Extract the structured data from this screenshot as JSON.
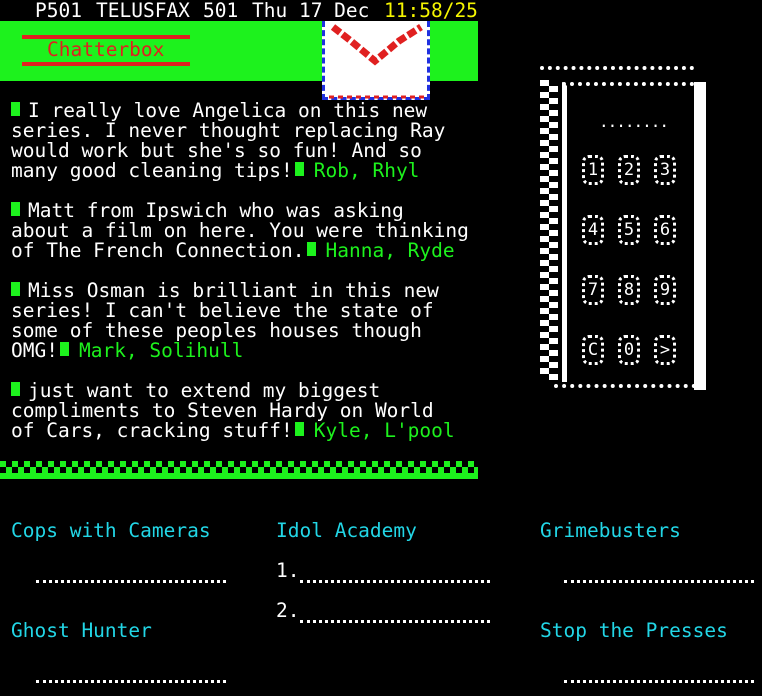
{
  "header": {
    "page_number": "P501",
    "service": "TELUSFAX",
    "page": "501",
    "date": "Thu 17 Dec",
    "time": "11:58/25"
  },
  "banner": {
    "title": "Chatterbox",
    "icon": "envelope-icon",
    "bg_color": "#1df21d",
    "title_color": "#e02020"
  },
  "messages": [
    {
      "lines": [
        "I really love Angelica on this new",
        "series. I never thought replacing Ray",
        "would work but she's so fun! And so",
        "many good cleaning tips!"
      ],
      "author": "Rob, Rhyl"
    },
    {
      "lines": [
        "Matt from Ipswich who was asking",
        "about a film on here. You were thinking",
        "of The French Connection."
      ],
      "author": "Hanna, Ryde"
    },
    {
      "lines": [
        "Miss Osman is brilliant in this new",
        "series! I can't believe the state of",
        "some of these peoples houses though",
        "OMG!"
      ],
      "author": "Mark, Solihull"
    },
    {
      "lines": [
        "just want to extend my biggest",
        "compliments to Steven Hardy on World",
        "of Cars, cracking stuff!"
      ],
      "author": "Kyle, L'pool"
    }
  ],
  "keypad": {
    "display": "........",
    "rows": [
      [
        "1",
        "2",
        "3"
      ],
      [
        "4",
        "5",
        "6"
      ],
      [
        "7",
        "8",
        "9"
      ],
      [
        "C",
        "0",
        ">"
      ]
    ]
  },
  "shows": {
    "col1": [
      "Cops with Cameras",
      "Ghost Hunter"
    ],
    "col2": {
      "title": "Idol Academy",
      "entries": [
        "1.",
        "2."
      ]
    },
    "col3": [
      "Grimebusters",
      "Stop the Presses"
    ]
  }
}
